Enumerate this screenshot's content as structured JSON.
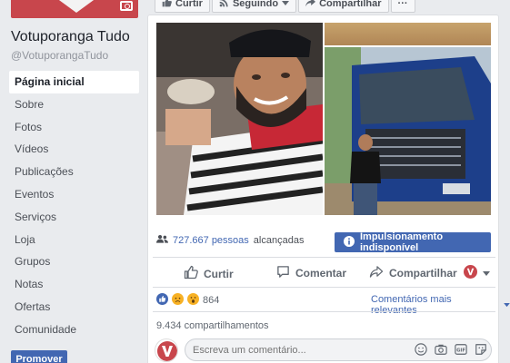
{
  "left": {
    "page_name": "Votuporanga Tudo",
    "page_handle": "@VotuporangaTudo",
    "nav": [
      {
        "label": "Página inicial",
        "active": true
      },
      {
        "label": "Sobre"
      },
      {
        "label": "Fotos"
      },
      {
        "label": "Vídeos"
      },
      {
        "label": "Publicações"
      },
      {
        "label": "Eventos"
      },
      {
        "label": "Serviços"
      },
      {
        "label": "Loja"
      },
      {
        "label": "Grupos"
      },
      {
        "label": "Notas"
      },
      {
        "label": "Ofertas"
      },
      {
        "label": "Comunidade"
      }
    ],
    "promote_label": "Promover"
  },
  "topbar": {
    "like": "Curtir",
    "following": "Seguindo",
    "share": "Compartilhar",
    "more": "···"
  },
  "post": {
    "reach_count": "727.667 pessoas",
    "reach_suffix": "alcançadas",
    "boost_label": "Impulsionamento indisponível",
    "actions": {
      "like": "Curtir",
      "comment": "Comentar",
      "share": "Compartilhar"
    },
    "reaction_count": "864",
    "sort_label": "Comentários mais relevantes",
    "shares": "9.434 compartilhamentos",
    "comment_placeholder": "Escreva um comentário..."
  },
  "colors": {
    "brand_blue": "#4267b2",
    "page_red": "#c8464c",
    "bg": "#e9ebee"
  }
}
